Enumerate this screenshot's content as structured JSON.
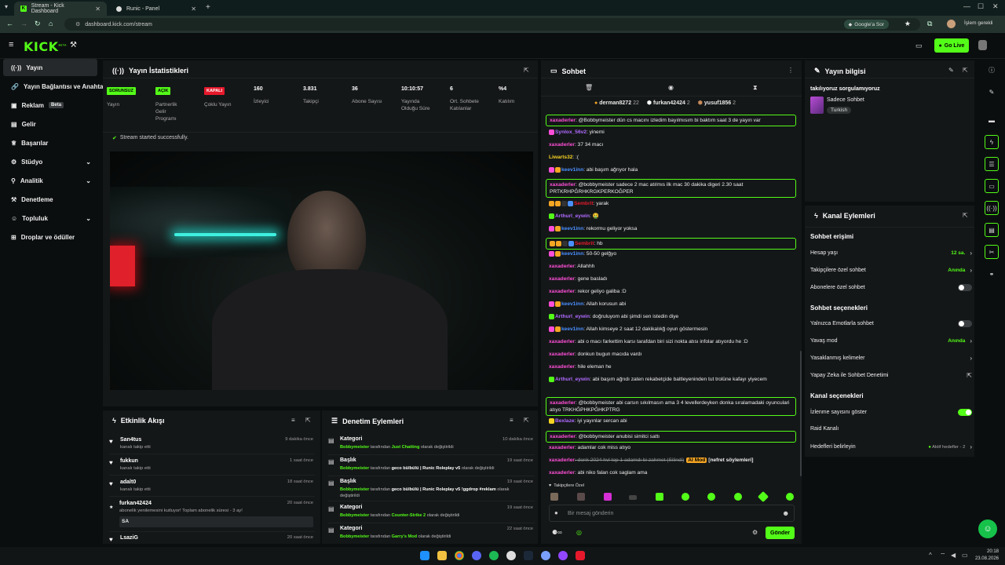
{
  "browser": {
    "tabs": [
      {
        "label": "Stream - Kick Dashboard",
        "active": true
      },
      {
        "label": "Runic - Panel",
        "active": false
      }
    ],
    "url": "dashboard.kick.com/stream",
    "google_btn": "Google'a Sor",
    "profile_label": "İşlem gerekli"
  },
  "topbar": {
    "logo": "KICK",
    "logo_sup": "BETA",
    "go_live": "Go Live"
  },
  "sidebar": {
    "items": [
      {
        "label": "Yayın",
        "icon": "broadcast-icon",
        "active": true
      },
      {
        "label": "Yayın Bağlantısı ve Anahtar",
        "icon": "link-icon"
      },
      {
        "label": "Reklam",
        "icon": "ad-icon",
        "badge": "Beta"
      },
      {
        "label": "Gelir",
        "icon": "revenue-icon"
      },
      {
        "label": "Başarılar",
        "icon": "trophy-icon"
      },
      {
        "label": "Stüdyo",
        "icon": "studio-icon",
        "chevron": true
      },
      {
        "label": "Analitik",
        "icon": "analytics-icon",
        "chevron": true
      },
      {
        "label": "Denetleme",
        "icon": "hammer-icon"
      },
      {
        "label": "Topluluk",
        "icon": "community-icon",
        "chevron": true
      },
      {
        "label": "Droplar ve ödüller",
        "icon": "gift-icon"
      }
    ]
  },
  "stats": {
    "title": "Yayın İstatistikleri",
    "items": [
      {
        "badge": "SORUNSUZ",
        "badge_color": "#53fc18",
        "label": "Yayın"
      },
      {
        "badge": "AÇIK",
        "badge_color": "#53fc18",
        "label": "Partnerlik Gelir Programı"
      },
      {
        "badge": "KAPALI",
        "badge_color": "#e5192b",
        "label": "Çoklu Yayın"
      },
      {
        "value": "160",
        "label": "İzleyici"
      },
      {
        "value": "3.831",
        "label": "Takipçi"
      },
      {
        "value": "36",
        "label": "Abone Sayısı"
      },
      {
        "value": "10:10:57",
        "label": "Yayında Olduğu Süre"
      },
      {
        "value": "6",
        "label": "Ort. Sohbete Katılanlar"
      },
      {
        "value": "%4",
        "label": "Katılım"
      }
    ],
    "status": "Stream started successfully."
  },
  "activity": {
    "title": "Etkinlik Akışı",
    "items": [
      {
        "name": "San4tus",
        "sub": "kanalı takip etti",
        "time": "9 dakika önce",
        "icon": "heart-icon"
      },
      {
        "name": "fukkun",
        "sub": "kanalı takip etti",
        "time": "1 saat önce",
        "icon": "heart-icon"
      },
      {
        "name": "adalt0",
        "sub": "kanalı takip etti",
        "time": "18 saat önce",
        "icon": "heart-icon"
      },
      {
        "name": "furkan42424",
        "sub": "abonelik yenilemesini kutluyor! Toplam abonelik süresi - 3 ay!",
        "time": "20 saat önce",
        "icon": "star-icon",
        "msg": "SA"
      },
      {
        "name": "LsaziG",
        "sub": "",
        "time": "20 saat önce",
        "icon": "heart-icon"
      }
    ]
  },
  "moderation": {
    "title": "Denetim Eylemleri",
    "items": [
      {
        "name": "Kategori",
        "who": "Bobbymeister",
        "mid": " tarafından ",
        "val": "Just Chatting",
        "end": " olarak değiştirildi",
        "time": "10 dakika önce"
      },
      {
        "name": "Başlık",
        "who": "Bobbymeister",
        "mid": " tarafından ",
        "val": "geco bülbülü | Runic Roleplay v5",
        "end": " olarak değiştirildi",
        "time": "19 saat önce"
      },
      {
        "name": "Başlık",
        "who": "Bobbymeister",
        "mid": " tarafından ",
        "val": "geco bülbülü | Runic Roleplay v5 !ggdrop #reklam",
        "end": " olarak değiştirildi",
        "time": "19 saat önce"
      },
      {
        "name": "Kategori",
        "who": "Bobbymeister",
        "mid": " tarafından ",
        "val": "Counter-Strike 2",
        "end": " olarak değiştirildi",
        "time": "19 saat önce"
      },
      {
        "name": "Kategori",
        "who": "Bobbymeister",
        "mid": " tarafından ",
        "val": "Garry's Mod",
        "end": " olarak değiştirildi",
        "time": "22 saat önce"
      }
    ]
  },
  "chat": {
    "title": "Sohbet",
    "pinned": [
      {
        "name": "derman8272",
        "count": "22",
        "color": "#f5a623"
      },
      {
        "name": "furkan42424",
        "count": "2",
        "color": "#ffffff"
      },
      {
        "name": "yusuf1856",
        "count": "2",
        "color": "#c78b5c"
      }
    ],
    "messages": [
      {
        "user": "xaxaderler",
        "color": "#ff4fd8",
        "text": ": @Bobbymeister dün cs macını izledim bayılmısım bi baktım saat 3 de yayın var",
        "hl": true
      },
      {
        "user": "Synlox_56v2",
        "color": "#b06bff",
        "text": ": yinemi",
        "badges": [
          "#ff4fd8"
        ]
      },
      {
        "user": "xaxaderler",
        "color": "#ff4fd8",
        "text": ": 37 34 macı"
      },
      {
        "user": "Liwarts32",
        "color": "#f5d323",
        "text": ": :("
      },
      {
        "user": "keev1inn",
        "color": "#4a90ff",
        "text": ": abi başım ağrıyor hala",
        "badges": [
          "#ff4fd8",
          "#f5a623"
        ]
      },
      {
        "user": "xaxaderler",
        "color": "#ff4fd8",
        "text": ": @bobbymeister sadece 2 mac atılmıs ilk mac 30 dakika digeri 2.30 saat PRTKRHPĞRHKRGKPERKOĞPER",
        "hl": true
      },
      {
        "user": "Sembrit",
        "color": "#e5192b",
        "text": ": yarak",
        "badges": [
          "#f5a623",
          "#f5a623",
          "#333",
          "#4a90ff"
        ]
      },
      {
        "user": "Arthurl_eywin",
        "color": "#b06bff",
        "text": ": 🤮",
        "badges": [
          "#53fc18"
        ]
      },
      {
        "user": "keev1inn",
        "color": "#4a90ff",
        "text": ": rekormu geliyor yoksa",
        "badges": [
          "#ff4fd8",
          "#f5a623"
        ]
      },
      {
        "user": "Sembrit",
        "color": "#e5192b",
        "text": ": hb",
        "badges": [
          "#f5a623",
          "#f5a623",
          "#333",
          "#4a90ff"
        ],
        "hl": true
      },
      {
        "user": "keev1inn",
        "color": "#4a90ff",
        "text": ": 50-50 gelğyo",
        "badges": [
          "#ff4fd8",
          "#f5a623"
        ]
      },
      {
        "user": "xaxaderler",
        "color": "#ff4fd8",
        "text": ": Allahhh"
      },
      {
        "user": "xaxaderler",
        "color": "#ff4fd8",
        "text": ": gene basladı"
      },
      {
        "user": "xaxaderler",
        "color": "#ff4fd8",
        "text": ": rekor geliyo galiba :D"
      },
      {
        "user": "keev1inn",
        "color": "#4a90ff",
        "text": ": Allah korusun abi",
        "badges": [
          "#ff4fd8",
          "#f5a623"
        ]
      },
      {
        "user": "Arthurl_eywin",
        "color": "#b06bff",
        "text": ": doğruluyom abi şimdi sen istedin diye",
        "badges": [
          "#53fc18"
        ]
      },
      {
        "user": "keev1inn",
        "color": "#4a90ff",
        "text": ": Allah kimseye 2 saat 12 dakikalıkğ oyun göstermesin",
        "badges": [
          "#ff4fd8",
          "#f5a623"
        ]
      },
      {
        "user": "xaxaderler",
        "color": "#ff4fd8",
        "text": ": abi o macı farkettim karsı tarafdan biri sizi nokta atısı infolar atıyordu he :D"
      },
      {
        "user": "xaxaderler",
        "color": "#ff4fd8",
        "text": ": donkun bugun macıda vardı"
      },
      {
        "user": "xaxaderler",
        "color": "#ff4fd8",
        "text": ": hile eleman he"
      },
      {
        "user": "Arthurl_eywin",
        "color": "#b06bff",
        "text": ": abi başım ağrıdı zaten rekabetçide baltleyeninden tut trolüne kafayı yiyecem",
        "badges": [
          "#53fc18"
        ]
      },
      {
        "user": "xaxaderler",
        "color": "#ff4fd8",
        "text": ": @bobbymeister abi carsın sıkılmasın ama 3 4 levellerdeyken donka sıralamadaki oyunculari atıyo TRKHĞPHKPĞHKPTRG",
        "hl": true
      },
      {
        "user": "Bexlaze",
        "color": "#b06bff",
        "text": ": iyi yayınlar sercan abi",
        "badges": [
          "#f5d323"
        ]
      },
      {
        "user": "xaxaderler",
        "color": "#ff4fd8",
        "text": ": @bobbymeister anubisi simitci sattı",
        "hl": true
      },
      {
        "user": "xaxaderler",
        "color": "#ff4fd8",
        "text": ": adamlar cok miss atıyo"
      },
      {
        "user": "xaxaderler",
        "color": "#ff4fd8",
        "text": ": donk 2024 hvl top 1 adamdı bi zahmet (Silindi)",
        "deleted": true,
        "tag": "AI Mod",
        "tag2": "[nefret söylemleri]"
      },
      {
        "user": "xaxaderler",
        "color": "#ff4fd8",
        "text": ": abi niko falan cok saglam ama"
      }
    ],
    "followers_label": "Takipçilere Özel",
    "input_placeholder": "Bir mesaj gönderin",
    "send": "Gönder"
  },
  "stream_info": {
    "title": "Yayın bilgisi",
    "stream_title": "takılıyoruz sorgulamıyoruz",
    "category": "Sadece Sohbet",
    "tag": "Turkish"
  },
  "channel_actions": {
    "title": "Kanal Eylemleri",
    "chat_access": "Sohbet erişimi",
    "account_age": {
      "label": "Hesap yaşı",
      "value": "12 sa."
    },
    "followers_only": {
      "label": "Takipçilere özel sohbet",
      "value": "Anında"
    },
    "subscribers_only": {
      "label": "Abonelere özel sohbet"
    },
    "chat_options": "Sohbet seçenekleri",
    "emotes_only": {
      "label": "Yalnızca Emotlarla sohbet"
    },
    "slow_mode": {
      "label": "Yavaş mod",
      "value": "Anında"
    },
    "banned_words": {
      "label": "Yasaklanmış kelimeler"
    },
    "ai_moderation": {
      "label": "Yapay Zeka ile Sohbet Denetimi"
    },
    "channel_options": "Kanal seçenekleri",
    "show_viewers": {
      "label": "İzlenme sayısını göster"
    },
    "raid": {
      "label": "Raid Kanalı"
    },
    "goals": {
      "label": "Hedefleri belirleyin",
      "value": "Aktif hedefler - 2"
    }
  },
  "taskbar": {
    "time": "20:18",
    "date": "23.08.2026"
  },
  "colors": {
    "accent": "#53fc18",
    "panel": "#141718",
    "bg": "#0b0e0f"
  }
}
